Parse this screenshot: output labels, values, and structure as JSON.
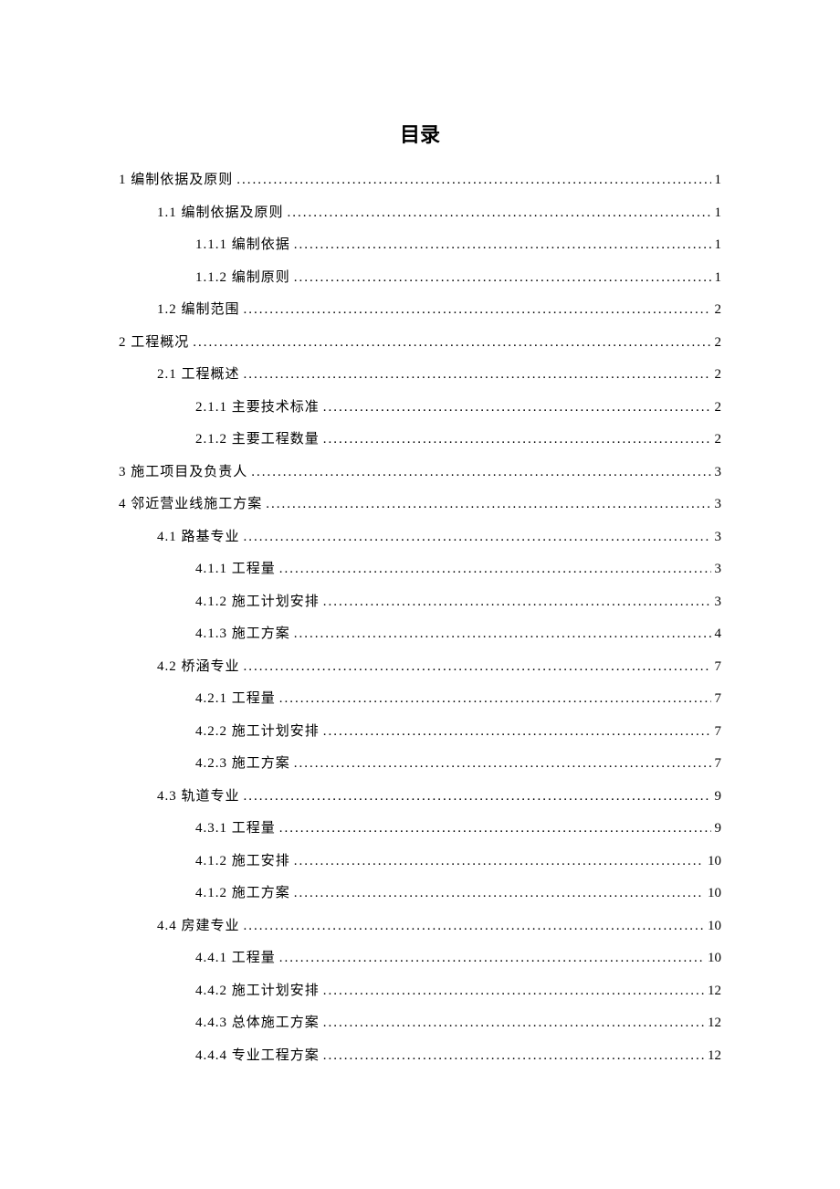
{
  "title": "目录",
  "toc": [
    {
      "label": "1 编制依据及原则",
      "page": "1",
      "indent": 0
    },
    {
      "label": "1.1 编制依据及原则",
      "page": "1",
      "indent": 1
    },
    {
      "label": "1.1.1 编制依据",
      "page": "1",
      "indent": 2
    },
    {
      "label": "1.1.2 编制原则",
      "page": "1",
      "indent": 2
    },
    {
      "label": "1.2 编制范围",
      "page": "2",
      "indent": 1
    },
    {
      "label": "2 工程概况",
      "page": "2",
      "indent": 0
    },
    {
      "label": "2.1 工程概述",
      "page": "2",
      "indent": 1
    },
    {
      "label": "2.1.1 主要技术标准",
      "page": "2",
      "indent": 2
    },
    {
      "label": "2.1.2 主要工程数量",
      "page": "2",
      "indent": 2
    },
    {
      "label": "3 施工项目及负责人",
      "page": "3",
      "indent": 0
    },
    {
      "label": "4 邻近营业线施工方案",
      "page": "3",
      "indent": 0
    },
    {
      "label": "4.1 路基专业",
      "page": "3",
      "indent": 1
    },
    {
      "label": "4.1.1 工程量",
      "page": "3",
      "indent": 2
    },
    {
      "label": "4.1.2 施工计划安排",
      "page": "3",
      "indent": 2
    },
    {
      "label": "4.1.3 施工方案",
      "page": "4",
      "indent": 2
    },
    {
      "label": "4.2 桥涵专业",
      "page": "7",
      "indent": 1
    },
    {
      "label": "4.2.1 工程量",
      "page": "7",
      "indent": 2
    },
    {
      "label": "4.2.2 施工计划安排",
      "page": "7",
      "indent": 2
    },
    {
      "label": "4.2.3 施工方案",
      "page": "7",
      "indent": 2
    },
    {
      "label": "4.3 轨道专业",
      "page": "9",
      "indent": 1
    },
    {
      "label": "4.3.1 工程量",
      "page": "9",
      "indent": 2
    },
    {
      "label": "4.1.2 施工安排",
      "page": "10",
      "indent": 2
    },
    {
      "label": "4.1.2 施工方案",
      "page": "10",
      "indent": 2
    },
    {
      "label": "4.4 房建专业",
      "page": "10",
      "indent": 1
    },
    {
      "label": "4.4.1 工程量",
      "page": "10",
      "indent": 2
    },
    {
      "label": "4.4.2 施工计划安排",
      "page": "12",
      "indent": 2
    },
    {
      "label": "4.4.3 总体施工方案",
      "page": "12",
      "indent": 2
    },
    {
      "label": "4.4.4 专业工程方案",
      "page": "12",
      "indent": 2
    }
  ]
}
